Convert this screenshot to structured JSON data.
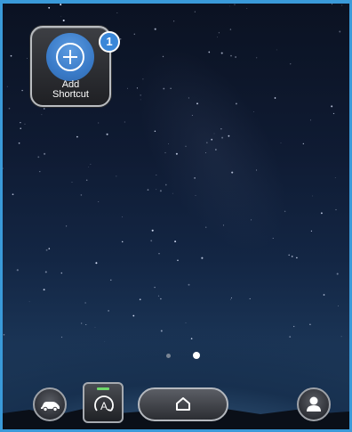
{
  "shortcut": {
    "label_line1": "Add",
    "label_line2": "Shortcut",
    "badge": "1",
    "icon": "plus-icon"
  },
  "pager": {
    "total_pages": 2,
    "current_page": 2
  },
  "dock": {
    "car_icon": "car-icon",
    "auto_icon": "auto-mode-icon",
    "auto_letter": "A",
    "home_icon": "home-icon",
    "user_icon": "user-profile-icon"
  },
  "colors": {
    "accent_blue": "#3a87d8",
    "indicator_green": "#6fd86a",
    "border": "#3a9ad9"
  }
}
